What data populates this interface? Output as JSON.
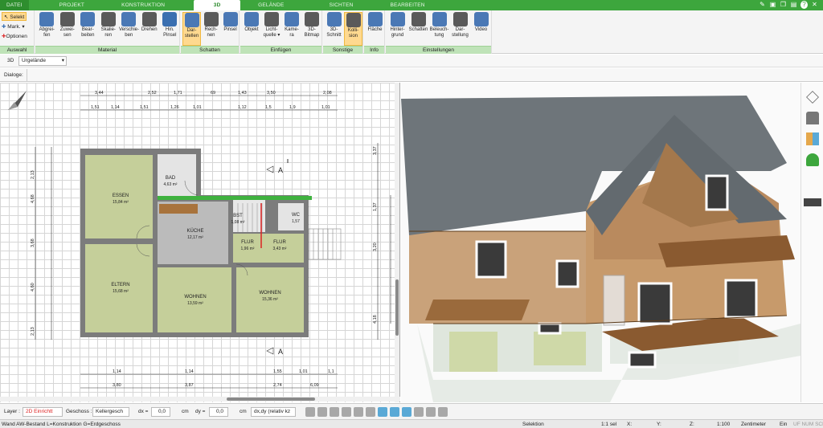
{
  "tabs": [
    "DATEI",
    "PROJEKT",
    "KONSTRUKTION",
    "3D",
    "GELÄNDE",
    "SICHTEN",
    "BEARBEITEN"
  ],
  "ribbon": {
    "selection": {
      "selekt": "Selekt",
      "mark": "Mark.",
      "optionen": "Optionen",
      "label": "Auswahl"
    },
    "material": {
      "label": "Material",
      "buttons": [
        "Abgrei-\nfen",
        "Zuwei-\nsen",
        "Bear-\nbeiten",
        "Skalie-\nren",
        "Verschie-\nben",
        "Drehen",
        "Hin.\nPinsel"
      ]
    },
    "schatten": {
      "label": "Schatten",
      "buttons": [
        "Dar-\nstellen",
        "Rech-\nnen",
        "Pinsel"
      ]
    },
    "einfuegen": {
      "label": "Einfügen",
      "buttons": [
        "Objekt",
        "Licht-\nquelle ▾",
        "Kame-\nra",
        "3D-\nBitmap"
      ]
    },
    "sonstige": {
      "label": "Sonstige",
      "buttons": [
        "3D-\nSchnitt",
        "Kolli-\nsion"
      ]
    },
    "info": {
      "label": "Info",
      "buttons": [
        "Fläche"
      ]
    },
    "einstellungen": {
      "label": "Einstellungen",
      "buttons": [
        "Hinter-\ngrund",
        "Schatten",
        "Beleuch-\ntung",
        "Dar-\nstellung",
        "Video"
      ]
    }
  },
  "toolbar2": {
    "view": "3D",
    "terrain": "Urgelände",
    "dialoge": "Dialoge:"
  },
  "plan": {
    "rooms": [
      {
        "name": "ESSEN",
        "area": "15,84 m²"
      },
      {
        "name": "BAD",
        "area": "4,63 m²"
      },
      {
        "name": "KÜCHE",
        "area": "12,17 m²"
      },
      {
        "name": "ELTERN",
        "area": "15,68 m²"
      },
      {
        "name": "WOHNEN",
        "area": "13,59 m²"
      },
      {
        "name": "WOHNEN",
        "area": "15,36 m²"
      },
      {
        "name": "FLUR",
        "area": "1,96 m²"
      },
      {
        "name": "FLUR",
        "area": "3,43 m²"
      },
      {
        "name": "WC",
        "area": "1,57"
      },
      {
        "name": "BST",
        "area": "1,08 m²"
      }
    ],
    "dims_top": [
      "3,44",
      "2,52",
      "1,71",
      "69",
      "1,43",
      "3,50",
      "2,08"
    ],
    "dims_top2": [
      "1,51",
      "1,14",
      "1,51",
      "1,26",
      "1,01",
      "1,12",
      "1,5",
      "1,9",
      "1,01"
    ],
    "dims_bottom": [
      "1,14",
      "1,14",
      "1,55",
      "1,01",
      "1,1"
    ],
    "dims_bottom2": [
      "3,80",
      "3,87",
      "2,74",
      "6,09"
    ],
    "dims_left": [
      "2,13",
      "4,68",
      "3,68",
      "4,60",
      "2,13"
    ],
    "dims_right": [
      "3,37",
      "1,37",
      "3,20",
      "4,18"
    ],
    "section_label": "A"
  },
  "status": {
    "layer_label": "Layer :",
    "layer_value": "2D Einrichtt",
    "geschoss_label": "Geschoss :",
    "geschoss_value": "Kellergesch",
    "dx_label": "dx =",
    "dx_value": "0,0",
    "dy_label": "dy =",
    "dy_value": "0,0",
    "unit": "cm",
    "mode": "dx,dy (relativ kz"
  },
  "bottom": {
    "text": "Wand AW-Bestand L=Konstruktion G=Erdgeschoss",
    "selektion": "Selektion",
    "scale": "1:1 sel",
    "x": "X:",
    "y": "Y:",
    "z": "Z:",
    "zoom": "1:100",
    "unit": "Zentimeter",
    "ein": "Ein",
    "flags": "UF NUM SCR"
  },
  "colors": {
    "green": "#3da63d",
    "room": "#c5cf9a",
    "wall": "#7c7c7c",
    "highlight": "#ffd98f"
  }
}
